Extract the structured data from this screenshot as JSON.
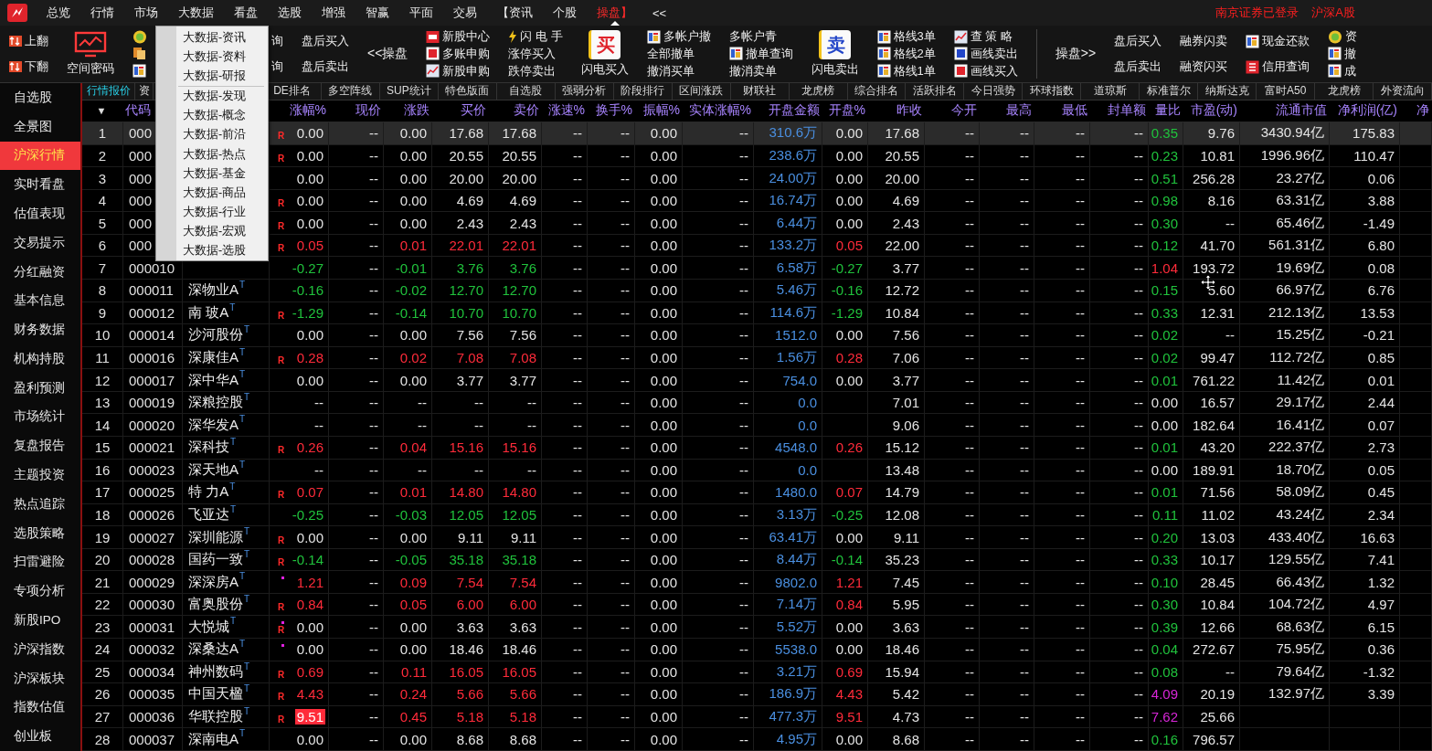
{
  "menu_bar": {
    "items": [
      {
        "label": "总览",
        "selected": false
      },
      {
        "label": "行情",
        "selected": false
      },
      {
        "label": "市场",
        "selected": false
      },
      {
        "label": "大数据",
        "selected": false
      },
      {
        "label": "看盘",
        "selected": false
      },
      {
        "label": "选股",
        "selected": false
      },
      {
        "label": "增强",
        "selected": false
      },
      {
        "label": "智赢",
        "selected": false
      },
      {
        "label": "平面",
        "selected": false
      },
      {
        "label": "交易",
        "selected": false
      },
      {
        "label": "【资讯",
        "selected": false
      },
      {
        "label": "个股",
        "selected": false
      },
      {
        "label": "操盘】",
        "selected": true
      },
      {
        "label": "<<",
        "selected": false
      }
    ],
    "login_status": "南京证券已登录",
    "market": "沪深A股"
  },
  "toolbar": [
    {
      "kind": "stack",
      "items": [
        {
          "kind": "arrows",
          "label": "上翻"
        },
        {
          "kind": "arrows",
          "label": "下翻"
        }
      ]
    },
    {
      "kind": "big",
      "tile": {
        "kind": "monitor"
      },
      "label": "空间密码"
    },
    {
      "kind": "stack",
      "items": [
        {
          "kind": "coin"
        },
        {
          "kind": "doc"
        },
        {
          "kind": "card"
        }
      ]
    },
    {
      "kind": "stack",
      "items": [
        {
          "kind": "text",
          "label": "询"
        },
        {
          "kind": "text",
          "label": "询"
        }
      ]
    },
    {
      "kind": "stack",
      "items": [
        {
          "kind": "text",
          "label": "盘后买入"
        },
        {
          "kind": "text",
          "label": "盘后卖出"
        }
      ]
    },
    {
      "kind": "single",
      "label": "<<操盘"
    },
    {
      "kind": "stack",
      "items": [
        {
          "kind": "ipo",
          "label": "新股中心"
        },
        {
          "kind": "buy",
          "label": "多账申购"
        },
        {
          "kind": "chart",
          "label": "新股申购"
        }
      ]
    },
    {
      "kind": "stack",
      "items": [
        {
          "kind": "bolt",
          "label": "闪 电 手"
        },
        {
          "kind": "text",
          "label": "涨停买入"
        },
        {
          "kind": "text",
          "label": "跌停卖出"
        }
      ]
    },
    {
      "kind": "big",
      "tile": {
        "kind": "buy",
        "glyph": "买"
      },
      "label": "闪电买入"
    },
    {
      "kind": "stack",
      "items": [
        {
          "kind": "card",
          "label": "多帐户撤"
        },
        {
          "kind": "text",
          "label": "全部撤单"
        },
        {
          "kind": "text",
          "label": "撤消买单"
        }
      ]
    },
    {
      "kind": "stack",
      "items": [
        {
          "kind": "text",
          "label": "多帐户青"
        },
        {
          "kind": "card",
          "label": "撤单查询"
        },
        {
          "kind": "text",
          "label": "撤消卖单"
        }
      ]
    },
    {
      "kind": "big",
      "tile": {
        "kind": "sell",
        "glyph": "卖"
      },
      "label": "闪电卖出"
    },
    {
      "kind": "stack",
      "items": [
        {
          "kind": "card",
          "label": "格线3单"
        },
        {
          "kind": "card",
          "label": "格线2单"
        },
        {
          "kind": "card",
          "label": "格线1单"
        }
      ]
    },
    {
      "kind": "stack",
      "items": [
        {
          "kind": "chart",
          "label": "查 策 略"
        },
        {
          "kind": "sell",
          "label": "画线卖出"
        },
        {
          "kind": "buy",
          "label": "画线买入"
        }
      ]
    },
    {
      "kind": "divider"
    },
    {
      "kind": "single",
      "label": "操盘>>"
    },
    {
      "kind": "stack",
      "items": [
        {
          "kind": "text",
          "label": "盘后买入"
        },
        {
          "kind": "text",
          "label": "盘后卖出"
        }
      ]
    },
    {
      "kind": "stack",
      "items": [
        {
          "kind": "text",
          "label": "融券闪卖"
        },
        {
          "kind": "text",
          "label": "融资闪买"
        }
      ]
    },
    {
      "kind": "stack",
      "items": [
        {
          "kind": "card",
          "label": "现金还款"
        },
        {
          "kind": "credit",
          "label": "信用查询"
        }
      ]
    },
    {
      "kind": "stack",
      "items": [
        {
          "kind": "coin",
          "label": "资"
        },
        {
          "kind": "card",
          "label": "撤"
        },
        {
          "kind": "card",
          "label": "成"
        }
      ]
    }
  ],
  "dropdown": {
    "groups": [
      [
        "大数据-资讯",
        "大数据-资料",
        "大数据-研报"
      ],
      [
        "大数据-发现",
        "大数据-概念",
        "大数据-前沿",
        "大数据-热点",
        "大数据-基金",
        "大数据-商品",
        "大数据-行业",
        "大数据-宏观",
        "大数据-选股"
      ]
    ]
  },
  "sidebar": {
    "items": [
      {
        "label": "自选股",
        "selected": false
      },
      {
        "label": "全景图",
        "selected": false
      },
      {
        "label": "沪深行情",
        "selected": true
      },
      {
        "label": "实时看盘",
        "selected": false
      },
      {
        "label": "估值表现",
        "selected": false
      },
      {
        "label": "交易提示",
        "selected": false
      },
      {
        "label": "分红融资",
        "selected": false
      },
      {
        "label": "基本信息",
        "selected": false
      },
      {
        "label": "财务数据",
        "selected": false
      },
      {
        "label": "机构持股",
        "selected": false
      },
      {
        "label": "盈利预测",
        "selected": false
      },
      {
        "label": "市场统计",
        "selected": false
      },
      {
        "label": "复盘报告",
        "selected": false
      },
      {
        "label": "主题投资",
        "selected": false
      },
      {
        "label": "热点追踪",
        "selected": false
      },
      {
        "label": "选股策略",
        "selected": false
      },
      {
        "label": "扫雷避险",
        "selected": false
      },
      {
        "label": "专项分析",
        "selected": false
      },
      {
        "label": "新股IPO",
        "selected": false
      },
      {
        "label": "沪深指数",
        "selected": false
      },
      {
        "label": "沪深板块",
        "selected": false
      },
      {
        "label": "指数估值",
        "selected": false
      },
      {
        "label": "创业板",
        "selected": false
      }
    ]
  },
  "tabs": [
    {
      "label": "行情报价",
      "selected": true
    },
    {
      "label": "资",
      "selected": false
    },
    {
      "label": "DE排名",
      "selected": false
    },
    {
      "label": "多空阵线",
      "selected": false
    },
    {
      "label": "SUP统计",
      "selected": false
    },
    {
      "label": "特色版面",
      "selected": false
    },
    {
      "label": "自选股",
      "selected": false
    },
    {
      "label": "强弱分析",
      "selected": false
    },
    {
      "label": "阶段排行",
      "selected": false
    },
    {
      "label": "区间涨跌",
      "selected": false
    },
    {
      "label": "财联社",
      "selected": false
    },
    {
      "label": "龙虎榜",
      "selected": false
    },
    {
      "label": "综合排名",
      "selected": false
    },
    {
      "label": "活跃排名",
      "selected": false
    },
    {
      "label": "今日强势",
      "selected": false
    },
    {
      "label": "环球指数",
      "selected": false
    },
    {
      "label": "道琼斯",
      "selected": false
    },
    {
      "label": "标准普尔",
      "selected": false
    },
    {
      "label": "纳斯达克",
      "selected": false
    },
    {
      "label": "富时A50",
      "selected": false
    },
    {
      "label": "龙虎榜",
      "selected": false
    },
    {
      "label": "外资流向",
      "selected": false
    }
  ],
  "table": {
    "sort_arrow": "▼",
    "code_header": "代码",
    "columns": [
      {
        "kind": "trend",
        "label": "涨幅%"
      },
      {
        "kind": "plain",
        "label": "现价"
      },
      {
        "kind": "trend",
        "label": "涨跌"
      },
      {
        "kind": "trend",
        "label": "买价"
      },
      {
        "kind": "trend",
        "label": "卖价"
      },
      {
        "kind": "plain",
        "label": "涨速%"
      },
      {
        "kind": "plain",
        "label": "换手%"
      },
      {
        "kind": "plain",
        "label": "振幅%"
      },
      {
        "kind": "plain",
        "label": "实体涨幅%"
      },
      {
        "kind": "amount",
        "label": "开盘金额"
      },
      {
        "kind": "trend",
        "label": "开盘%"
      },
      {
        "kind": "plain",
        "label": "昨收"
      },
      {
        "kind": "plain",
        "label": "今开"
      },
      {
        "kind": "plain",
        "label": "最高"
      },
      {
        "kind": "plain",
        "label": "最低"
      },
      {
        "kind": "plain",
        "label": "封单额"
      },
      {
        "kind": "ratio",
        "label": "量比"
      },
      {
        "kind": "plain",
        "label": "市盈(动)"
      },
      {
        "kind": "plain",
        "label": "流通市值"
      },
      {
        "kind": "plain",
        "label": "净利润(亿)"
      },
      {
        "label": "净"
      }
    ],
    "rows": [
      {
        "no": "1",
        "code": "000",
        "mark": "R",
        "dot": false,
        "kind": "flat",
        "color": "#20c23c",
        "limit_up": false,
        "selected": true,
        "cells": [
          "0.00",
          "--",
          "0.00",
          "17.68",
          "17.68",
          "--",
          "--",
          "0.00",
          "--",
          "310.6万",
          "0.00",
          "17.68",
          "--",
          "--",
          "--",
          "--",
          "0.35",
          "9.76",
          "3430.94亿",
          "175.83"
        ]
      },
      {
        "no": "2",
        "code": "000",
        "mark": "R",
        "dot": false,
        "kind": "flat",
        "color": "#20c23c",
        "limit_up": false,
        "selected": false,
        "cells": [
          "0.00",
          "--",
          "0.00",
          "20.55",
          "20.55",
          "--",
          "--",
          "0.00",
          "--",
          "238.6万",
          "0.00",
          "20.55",
          "--",
          "--",
          "--",
          "--",
          "0.23",
          "10.81",
          "1996.96亿",
          "110.47"
        ]
      },
      {
        "no": "3",
        "code": "000",
        "dot": false,
        "kind": "flat",
        "color": "#20c23c",
        "limit_up": false,
        "selected": false,
        "cells": [
          "0.00",
          "--",
          "0.00",
          "20.00",
          "20.00",
          "--",
          "--",
          "0.00",
          "--",
          "24.00万",
          "0.00",
          "20.00",
          "--",
          "--",
          "--",
          "--",
          "0.51",
          "256.28",
          "23.27亿",
          "0.06"
        ]
      },
      {
        "no": "4",
        "code": "000",
        "mark": "R",
        "dot": false,
        "kind": "flat",
        "color": "#20c23c",
        "limit_up": false,
        "selected": false,
        "cells": [
          "0.00",
          "--",
          "0.00",
          "4.69",
          "4.69",
          "--",
          "--",
          "0.00",
          "--",
          "16.74万",
          "0.00",
          "4.69",
          "--",
          "--",
          "--",
          "--",
          "0.98",
          "8.16",
          "63.31亿",
          "3.88"
        ]
      },
      {
        "no": "5",
        "code": "000",
        "mark": "R",
        "dot": false,
        "kind": "flat",
        "color": "#20c23c",
        "limit_up": false,
        "selected": false,
        "cells": [
          "0.00",
          "--",
          "0.00",
          "2.43",
          "2.43",
          "--",
          "--",
          "0.00",
          "--",
          "6.44万",
          "0.00",
          "2.43",
          "--",
          "--",
          "--",
          "--",
          "0.30",
          "--",
          "65.46亿",
          "-1.49"
        ]
      },
      {
        "no": "6",
        "code": "000",
        "mark": "R",
        "dot": false,
        "kind": "up",
        "color": "#20c23c",
        "limit_up": false,
        "selected": false,
        "cells": [
          "0.05",
          "--",
          "0.01",
          "22.01",
          "22.01",
          "--",
          "--",
          "0.00",
          "--",
          "133.2万",
          "0.05",
          "22.00",
          "--",
          "--",
          "--",
          "--",
          "0.12",
          "41.70",
          "561.31亿",
          "6.80"
        ]
      },
      {
        "no": "7",
        "code": "000010",
        "dot": false,
        "kind": "down",
        "color": "#ff2b3a",
        "limit_up": false,
        "selected": false,
        "cells": [
          "-0.27",
          "--",
          "-0.01",
          "3.76",
          "3.76",
          "--",
          "--",
          "0.00",
          "--",
          "6.58万",
          "-0.27",
          "3.77",
          "--",
          "--",
          "--",
          "--",
          "1.04",
          "193.72",
          "19.69亿",
          "0.08"
        ]
      },
      {
        "no": "8",
        "code": "000011",
        "name": "深物业A",
        "tag": "T",
        "dot": false,
        "kind": "down",
        "color": "#20c23c",
        "limit_up": false,
        "selected": false,
        "cells": [
          "-0.16",
          "--",
          "-0.02",
          "12.70",
          "12.70",
          "--",
          "--",
          "0.00",
          "--",
          "5.46万",
          "-0.16",
          "12.72",
          "--",
          "--",
          "--",
          "--",
          "0.15",
          "5.60",
          "66.97亿",
          "6.76"
        ]
      },
      {
        "no": "9",
        "code": "000012",
        "name": "南 玻A",
        "tag": "T",
        "mark": "R",
        "dot": false,
        "kind": "down",
        "color": "#20c23c",
        "limit_up": false,
        "selected": false,
        "cells": [
          "-1.29",
          "--",
          "-0.14",
          "10.70",
          "10.70",
          "--",
          "--",
          "0.00",
          "--",
          "114.6万",
          "-1.29",
          "10.84",
          "--",
          "--",
          "--",
          "--",
          "0.33",
          "12.31",
          "212.13亿",
          "13.53"
        ]
      },
      {
        "no": "10",
        "code": "000014",
        "name": "沙河股份",
        "tag": "T",
        "dot": false,
        "kind": "flat",
        "color": "#20c23c",
        "limit_up": false,
        "selected": false,
        "cells": [
          "0.00",
          "--",
          "0.00",
          "7.56",
          "7.56",
          "--",
          "--",
          "0.00",
          "--",
          "1512.0",
          "0.00",
          "7.56",
          "--",
          "--",
          "--",
          "--",
          "0.02",
          "--",
          "15.25亿",
          "-0.21"
        ]
      },
      {
        "no": "11",
        "code": "000016",
        "name": "深康佳A",
        "tag": "T",
        "mark": "R",
        "dot": false,
        "kind": "up",
        "color": "#20c23c",
        "limit_up": false,
        "selected": false,
        "cells": [
          "0.28",
          "--",
          "0.02",
          "7.08",
          "7.08",
          "--",
          "--",
          "0.00",
          "--",
          "1.56万",
          "0.28",
          "7.06",
          "--",
          "--",
          "--",
          "--",
          "0.02",
          "99.47",
          "112.72亿",
          "0.85"
        ]
      },
      {
        "no": "12",
        "code": "000017",
        "name": "深中华A",
        "tag": "T",
        "dot": false,
        "kind": "flat",
        "color": "#20c23c",
        "limit_up": false,
        "selected": false,
        "cells": [
          "0.00",
          "--",
          "0.00",
          "3.77",
          "3.77",
          "--",
          "--",
          "0.00",
          "--",
          "754.0",
          "0.00",
          "3.77",
          "--",
          "--",
          "--",
          "--",
          "0.01",
          "761.22",
          "11.42亿",
          "0.01"
        ]
      },
      {
        "no": "13",
        "code": "000019",
        "name": "深粮控股",
        "tag": "T",
        "dot": false,
        "kind": "flat",
        "color": "#e4e4e4",
        "limit_up": false,
        "selected": false,
        "cells": [
          "--",
          "--",
          "--",
          "--",
          "--",
          "--",
          "--",
          "0.00",
          "--",
          "0.0",
          null,
          "7.01",
          "--",
          "--",
          "--",
          "--",
          "0.00",
          "16.57",
          "29.17亿",
          "2.44"
        ]
      },
      {
        "no": "14",
        "code": "000020",
        "name": "深华发A",
        "tag": "T",
        "dot": false,
        "kind": "flat",
        "color": "#e4e4e4",
        "limit_up": false,
        "selected": false,
        "cells": [
          "--",
          "--",
          "--",
          "--",
          "--",
          "--",
          "--",
          "0.00",
          "--",
          "0.0",
          null,
          "9.06",
          "--",
          "--",
          "--",
          "--",
          "0.00",
          "182.64",
          "16.41亿",
          "0.07"
        ]
      },
      {
        "no": "15",
        "code": "000021",
        "name": "深科技",
        "tag": "T",
        "mark": "R",
        "dot": false,
        "kind": "up",
        "color": "#20c23c",
        "limit_up": false,
        "selected": false,
        "cells": [
          "0.26",
          "--",
          "0.04",
          "15.16",
          "15.16",
          "--",
          "--",
          "0.00",
          "--",
          "4548.0",
          "0.26",
          "15.12",
          "--",
          "--",
          "--",
          "--",
          "0.01",
          "43.20",
          "222.37亿",
          "2.73"
        ]
      },
      {
        "no": "16",
        "code": "000023",
        "name": "深天地A",
        "tag": "T",
        "dot": false,
        "kind": "flat",
        "color": "#e4e4e4",
        "limit_up": false,
        "selected": false,
        "cells": [
          "--",
          "--",
          "--",
          "--",
          "--",
          "--",
          "--",
          "0.00",
          "--",
          "0.0",
          null,
          "13.48",
          "--",
          "--",
          "--",
          "--",
          "0.00",
          "189.91",
          "18.70亿",
          "0.05"
        ]
      },
      {
        "no": "17",
        "code": "000025",
        "name": "特 力A",
        "tag": "T",
        "mark": "R",
        "dot": false,
        "kind": "up",
        "color": "#20c23c",
        "limit_up": false,
        "selected": false,
        "cells": [
          "0.07",
          "--",
          "0.01",
          "14.80",
          "14.80",
          "--",
          "--",
          "0.00",
          "--",
          "1480.0",
          "0.07",
          "14.79",
          "--",
          "--",
          "--",
          "--",
          "0.01",
          "71.56",
          "58.09亿",
          "0.45"
        ]
      },
      {
        "no": "18",
        "code": "000026",
        "name": "飞亚达",
        "tag": "T",
        "dot": false,
        "kind": "down",
        "color": "#20c23c",
        "limit_up": false,
        "selected": false,
        "cells": [
          "-0.25",
          "--",
          "-0.03",
          "12.05",
          "12.05",
          "--",
          "--",
          "0.00",
          "--",
          "3.13万",
          "-0.25",
          "12.08",
          "--",
          "--",
          "--",
          "--",
          "0.11",
          "11.02",
          "43.24亿",
          "2.34"
        ]
      },
      {
        "no": "19",
        "code": "000027",
        "name": "深圳能源",
        "tag": "T",
        "mark": "R",
        "dot": false,
        "kind": "flat",
        "color": "#20c23c",
        "limit_up": false,
        "selected": false,
        "cells": [
          "0.00",
          "--",
          "0.00",
          "9.11",
          "9.11",
          "--",
          "--",
          "0.00",
          "--",
          "63.41万",
          "0.00",
          "9.11",
          "--",
          "--",
          "--",
          "--",
          "0.20",
          "13.03",
          "433.40亿",
          "16.63"
        ]
      },
      {
        "no": "20",
        "code": "000028",
        "name": "国药一致",
        "tag": "T",
        "mark": "R",
        "dot": false,
        "kind": "down",
        "color": "#20c23c",
        "limit_up": false,
        "selected": false,
        "cells": [
          "-0.14",
          "--",
          "-0.05",
          "35.18",
          "35.18",
          "--",
          "--",
          "0.00",
          "--",
          "8.44万",
          "-0.14",
          "35.23",
          "--",
          "--",
          "--",
          "--",
          "0.33",
          "10.17",
          "129.55亿",
          "7.41"
        ]
      },
      {
        "no": "21",
        "code": "000029",
        "name": "深深房A",
        "tag": "T",
        "dot": true,
        "kind": "up",
        "color": "#20c23c",
        "limit_up": false,
        "selected": false,
        "cells": [
          "1.21",
          "--",
          "0.09",
          "7.54",
          "7.54",
          "--",
          "--",
          "0.00",
          "--",
          "9802.0",
          "1.21",
          "7.45",
          "--",
          "--",
          "--",
          "--",
          "0.10",
          "28.45",
          "66.43亿",
          "1.32"
        ]
      },
      {
        "no": "22",
        "code": "000030",
        "name": "富奥股份",
        "tag": "T",
        "mark": "R",
        "dot": false,
        "kind": "up",
        "color": "#20c23c",
        "limit_up": false,
        "selected": false,
        "cells": [
          "0.84",
          "--",
          "0.05",
          "6.00",
          "6.00",
          "--",
          "--",
          "0.00",
          "--",
          "7.14万",
          "0.84",
          "5.95",
          "--",
          "--",
          "--",
          "--",
          "0.30",
          "10.84",
          "104.72亿",
          "4.97"
        ]
      },
      {
        "no": "23",
        "code": "000031",
        "name": "大悦城",
        "tag": "T",
        "mark": "R",
        "dot": true,
        "kind": "flat",
        "color": "#20c23c",
        "limit_up": false,
        "selected": false,
        "cells": [
          "0.00",
          "--",
          "0.00",
          "3.63",
          "3.63",
          "--",
          "--",
          "0.00",
          "--",
          "5.52万",
          "0.00",
          "3.63",
          "--",
          "--",
          "--",
          "--",
          "0.39",
          "12.66",
          "68.63亿",
          "6.15"
        ]
      },
      {
        "no": "24",
        "code": "000032",
        "name": "深桑达A",
        "tag": "T",
        "dot": true,
        "kind": "flat",
        "color": "#20c23c",
        "limit_up": false,
        "selected": false,
        "cells": [
          "0.00",
          "--",
          "0.00",
          "18.46",
          "18.46",
          "--",
          "--",
          "0.00",
          "--",
          "5538.0",
          "0.00",
          "18.46",
          "--",
          "--",
          "--",
          "--",
          "0.04",
          "272.67",
          "75.95亿",
          "0.36"
        ]
      },
      {
        "no": "25",
        "code": "000034",
        "name": "神州数码",
        "tag": "T",
        "mark": "R",
        "dot": false,
        "kind": "up",
        "color": "#20c23c",
        "limit_up": false,
        "selected": false,
        "cells": [
          "0.69",
          "--",
          "0.11",
          "16.05",
          "16.05",
          "--",
          "--",
          "0.00",
          "--",
          "3.21万",
          "0.69",
          "15.94",
          "--",
          "--",
          "--",
          "--",
          "0.08",
          "--",
          "79.64亿",
          "-1.32"
        ]
      },
      {
        "no": "26",
        "code": "000035",
        "name": "中国天楹",
        "tag": "T",
        "mark": "R",
        "dot": false,
        "kind": "up",
        "color": "#d826d8",
        "limit_up": false,
        "selected": false,
        "cells": [
          "4.43",
          "--",
          "0.24",
          "5.66",
          "5.66",
          "--",
          "--",
          "0.00",
          "--",
          "186.9万",
          "4.43",
          "5.42",
          "--",
          "--",
          "--",
          "--",
          "4.09",
          "20.19",
          "132.97亿",
          "3.39"
        ]
      },
      {
        "no": "27",
        "code": "000036",
        "name": "华联控股",
        "tag": "T",
        "mark": "R",
        "dot": false,
        "kind": "up",
        "color": "#d826d8",
        "limit_up": true,
        "selected": false,
        "cells": [
          "9.51",
          "--",
          "0.45",
          "5.18",
          "5.18",
          "--",
          "--",
          "0.00",
          "--",
          "477.3万",
          "9.51",
          "4.73",
          "--",
          "--",
          "--",
          "--",
          "7.62",
          "25.66",
          null,
          null
        ]
      },
      {
        "no": "28",
        "code": "000037",
        "name": "深南电A",
        "tag": "T",
        "dot": false,
        "kind": "flat",
        "color": "#20c23c",
        "limit_up": false,
        "selected": false,
        "cells": [
          "0.00",
          "--",
          "0.00",
          "8.68",
          "8.68",
          "--",
          "--",
          "0.00",
          "--",
          "4.95万",
          "0.00",
          "8.68",
          "--",
          "--",
          "--",
          "--",
          "0.16",
          "796.57",
          null,
          null
        ]
      }
    ]
  }
}
